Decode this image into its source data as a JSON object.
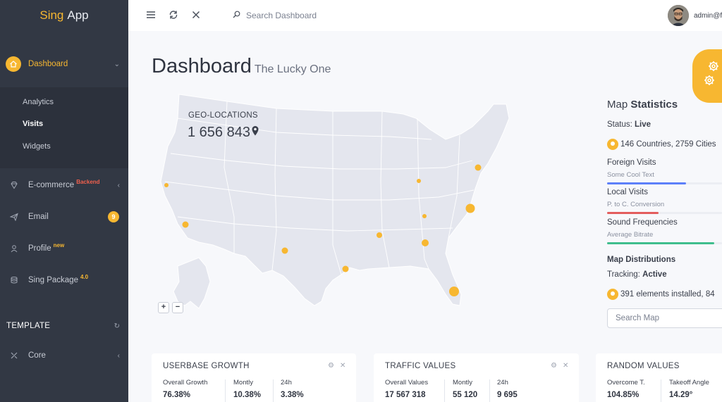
{
  "sidebar": {
    "brand_a": "Sing",
    "brand_b": "App",
    "dashboard_label": "Dashboard",
    "sub_items": [
      "Analytics",
      "Visits",
      "Widgets"
    ],
    "ecommerce_label": "E-commerce",
    "ecommerce_badge": "Backend",
    "email_label": "Email",
    "email_count": "9",
    "profile_label": "Profile",
    "profile_badge": "new",
    "package_label": "Sing Package",
    "package_badge": "4.0",
    "section_title": "TEMPLATE",
    "core_label": "Core"
  },
  "header": {
    "search_placeholder": "Search Dashboard",
    "user_label": "admin@f"
  },
  "page": {
    "title": "Dashboard",
    "subtitle": "The Lucky One"
  },
  "map": {
    "geo_label": "GEO-LOCATIONS",
    "geo_value": "1 656 843",
    "zoom_in": "+",
    "zoom_out": "−"
  },
  "stats": {
    "title_a": "Map",
    "title_b": "Statistics",
    "status_label": "Status:",
    "status_value": "Live",
    "countries": "146 Countries, 2759 Cities",
    "foreign_label": "Foreign Visits",
    "foreign_note": "Some Cool Text",
    "foreign_pct": 0.69,
    "local_label": "Local Visits",
    "local_note": "P. to C. Conversion",
    "local_pct": 0.45,
    "sound_label": "Sound Frequencies",
    "sound_note": "Average Bitrate",
    "sound_pct": 0.93,
    "distributions_title": "Map Distributions",
    "tracking_label": "Tracking:",
    "tracking_value": "Active",
    "installed": "391 elements installed, 84",
    "search_placeholder": "Search Map",
    "colors": {
      "foreign": "#5d80f9",
      "local": "#e35d5d",
      "sound": "#3fbe8d"
    }
  },
  "cards": [
    {
      "title": "USERBASE GROWTH",
      "metrics": [
        {
          "label": "Overall Growth",
          "value": "76.38%"
        },
        {
          "label": "Montly",
          "value": "10.38%"
        },
        {
          "label": "24h",
          "value": "3.38%"
        }
      ]
    },
    {
      "title": "TRAFFIC VALUES",
      "metrics": [
        {
          "label": "Overall Values",
          "value": "17 567 318"
        },
        {
          "label": "Montly",
          "value": "55 120"
        },
        {
          "label": "24h",
          "value": "9 695"
        }
      ]
    },
    {
      "title": "RANDOM VALUES",
      "metrics": [
        {
          "label": "Overcome T.",
          "value": "104.85%"
        },
        {
          "label": "Takeoff Angle",
          "value": "14.29°"
        }
      ]
    }
  ],
  "colors": {
    "accent": "#f7b731",
    "sidebar": "#323844",
    "map_land": "#e4e6ee"
  }
}
